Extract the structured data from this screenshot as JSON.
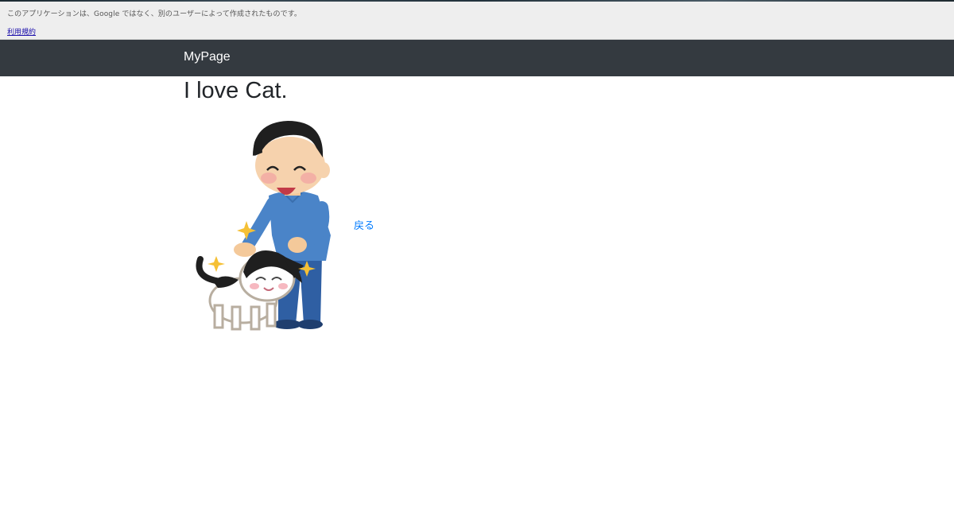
{
  "banner": {
    "warning": "このアプリケーションは、Google ではなく、別のユーザーによって作成されたものです。",
    "terms_link": "利用規約"
  },
  "navbar": {
    "brand": "MyPage"
  },
  "main": {
    "heading": "I love Cat.",
    "back_link": "戻る"
  },
  "colors": {
    "navbar_bg": "#343a40",
    "link": "#007bff",
    "banner_bg": "#eeeeee"
  }
}
